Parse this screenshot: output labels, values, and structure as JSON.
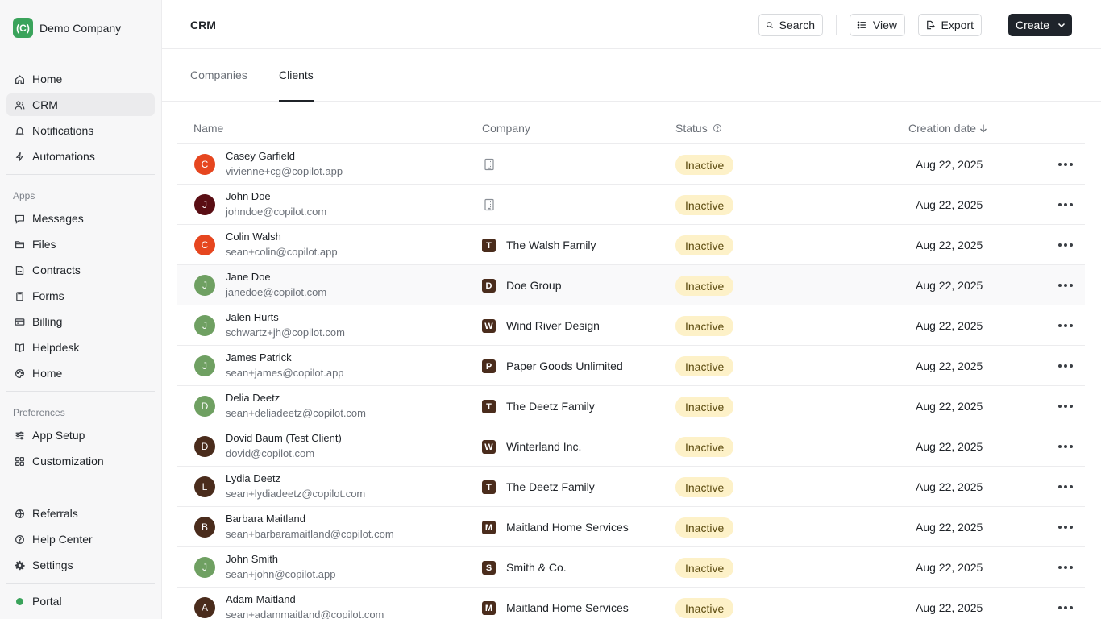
{
  "brand": {
    "logo_text": "(C)",
    "name": "Demo Company"
  },
  "sidebar": {
    "main": [
      {
        "label": "Home",
        "icon": "home-icon"
      },
      {
        "label": "CRM",
        "icon": "users-icon",
        "active": true
      },
      {
        "label": "Notifications",
        "icon": "bell-icon"
      },
      {
        "label": "Automations",
        "icon": "bolt-icon"
      }
    ],
    "apps_label": "Apps",
    "apps": [
      {
        "label": "Messages",
        "icon": "message-icon"
      },
      {
        "label": "Files",
        "icon": "folder-icon"
      },
      {
        "label": "Contracts",
        "icon": "contract-icon"
      },
      {
        "label": "Forms",
        "icon": "clipboard-icon"
      },
      {
        "label": "Billing",
        "icon": "credit-card-icon"
      },
      {
        "label": "Helpdesk",
        "icon": "book-icon"
      },
      {
        "label": "Home",
        "icon": "palette-icon"
      }
    ],
    "preferences_label": "Preferences",
    "preferences": [
      {
        "label": "App Setup",
        "icon": "sliders-icon"
      },
      {
        "label": "Customization",
        "icon": "grid-icon"
      }
    ],
    "bottom": [
      {
        "label": "Referrals",
        "icon": "globe-icon"
      },
      {
        "label": "Help Center",
        "icon": "help-icon"
      },
      {
        "label": "Settings",
        "icon": "gear-icon"
      }
    ],
    "portal": {
      "label": "Portal",
      "status_color": "#3aa35b"
    }
  },
  "header": {
    "title": "CRM",
    "search_label": "Search",
    "view_label": "View",
    "export_label": "Export",
    "create_label": "Create"
  },
  "tabs": [
    {
      "label": "Companies",
      "active": false
    },
    {
      "label": "Clients",
      "active": true
    }
  ],
  "table": {
    "columns": {
      "name": "Name",
      "company": "Company",
      "status": "Status",
      "creation_date": "Creation date"
    },
    "rows": [
      {
        "initial": "C",
        "avatar_color": "#e6461f",
        "name": "Casey Garfield",
        "email": "vivienne+cg@copilot.app",
        "company_initial": "",
        "company": "",
        "status": "Inactive",
        "date": "Aug 22, 2025"
      },
      {
        "initial": "J",
        "avatar_color": "#5a0e14",
        "name": "John Doe",
        "email": "johndoe@copilot.com",
        "company_initial": "",
        "company": "",
        "status": "Inactive",
        "date": "Aug 22, 2025"
      },
      {
        "initial": "C",
        "avatar_color": "#e6461f",
        "name": "Colin Walsh",
        "email": "sean+colin@copilot.app",
        "company_initial": "T",
        "company": "The Walsh Family",
        "status": "Inactive",
        "date": "Aug 22, 2025"
      },
      {
        "initial": "J",
        "avatar_color": "#6fa062",
        "name": "Jane Doe",
        "email": "janedoe@copilot.com",
        "company_initial": "D",
        "company": "Doe Group",
        "status": "Inactive",
        "date": "Aug 22, 2025"
      },
      {
        "initial": "J",
        "avatar_color": "#6fa062",
        "name": "Jalen Hurts",
        "email": "schwartz+jh@copilot.com",
        "company_initial": "W",
        "company": "Wind River Design",
        "status": "Inactive",
        "date": "Aug 22, 2025"
      },
      {
        "initial": "J",
        "avatar_color": "#6fa062",
        "name": "James Patrick",
        "email": "sean+james@copilot.app",
        "company_initial": "P",
        "company": "Paper Goods Unlimited",
        "status": "Inactive",
        "date": "Aug 22, 2025"
      },
      {
        "initial": "D",
        "avatar_color": "#6fa062",
        "name": "Delia Deetz",
        "email": "sean+deliadeetz@copilot.com",
        "company_initial": "T",
        "company": "The Deetz Family",
        "status": "Inactive",
        "date": "Aug 22, 2025"
      },
      {
        "initial": "D",
        "avatar_color": "#4a2c1c",
        "name": "Dovid Baum (Test Client)",
        "email": "dovid@copilot.com",
        "company_initial": "W",
        "company": "Winterland Inc.",
        "status": "Inactive",
        "date": "Aug 22, 2025"
      },
      {
        "initial": "L",
        "avatar_color": "#4a2c1c",
        "name": "Lydia Deetz",
        "email": "sean+lydiadeetz@copilot.com",
        "company_initial": "T",
        "company": "The Deetz Family",
        "status": "Inactive",
        "date": "Aug 22, 2025"
      },
      {
        "initial": "B",
        "avatar_color": "#4a2c1c",
        "name": "Barbara Maitland",
        "email": "sean+barbaramaitland@copilot.com",
        "company_initial": "M",
        "company": "Maitland Home Services",
        "status": "Inactive",
        "date": "Aug 22, 2025"
      },
      {
        "initial": "J",
        "avatar_color": "#6fa062",
        "name": "John Smith",
        "email": "sean+john@copilot.app",
        "company_initial": "S",
        "company": "Smith & Co.",
        "status": "Inactive",
        "date": "Aug 22, 2025"
      },
      {
        "initial": "A",
        "avatar_color": "#4a2c1c",
        "name": "Adam Maitland",
        "email": "sean+adammaitland@copilot.com",
        "company_initial": "M",
        "company": "Maitland Home Services",
        "status": "Inactive",
        "date": "Aug 22, 2025"
      }
    ]
  }
}
